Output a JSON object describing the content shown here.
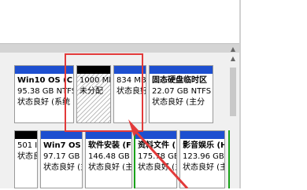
{
  "row1": [
    {
      "name": "Win10 OS  (C:)",
      "size": "95.38 GB NTFS",
      "status": "状态良好 (系统",
      "bar": "blue"
    },
    {
      "name": "",
      "size": "1000 MB",
      "status": "未分配",
      "bar": "black",
      "unallocated": true
    },
    {
      "name": "",
      "size": "834 MB",
      "status": "状态良好",
      "bar": "blue"
    },
    {
      "name": "固态硬盘临时区",
      "size": "22.07 GB NTFS",
      "status": "状态良好 (主分",
      "bar": "blue"
    }
  ],
  "row2": [
    {
      "name": "",
      "size": "501 I",
      "status": "状态良",
      "bar": "black"
    },
    {
      "name": "Win7 OS  (D:",
      "size": "97.17 GB NTFS",
      "status": "状态良好 (主",
      "bar": "blue"
    },
    {
      "name": "软件安装  (F",
      "size": "146.48 GB NTFS",
      "status": "状态良好 (主",
      "bar": "blue"
    },
    {
      "name": "资料文件  (",
      "size": "175.78 GB NTF",
      "status": "状态良好 (主",
      "bar": "blue"
    },
    {
      "name": "影音娱乐  (H",
      "size": "123.96 GB NTF",
      "status": "状态良好 (主",
      "bar": "blue"
    }
  ],
  "scroll": {
    "up": "▲",
    "down": "▼"
  },
  "colors": {
    "primary_bar": "#1d4fd0",
    "unallocated_bar": "#000000",
    "highlight": "#e23a3a",
    "logical_border": "#1aa21a"
  }
}
